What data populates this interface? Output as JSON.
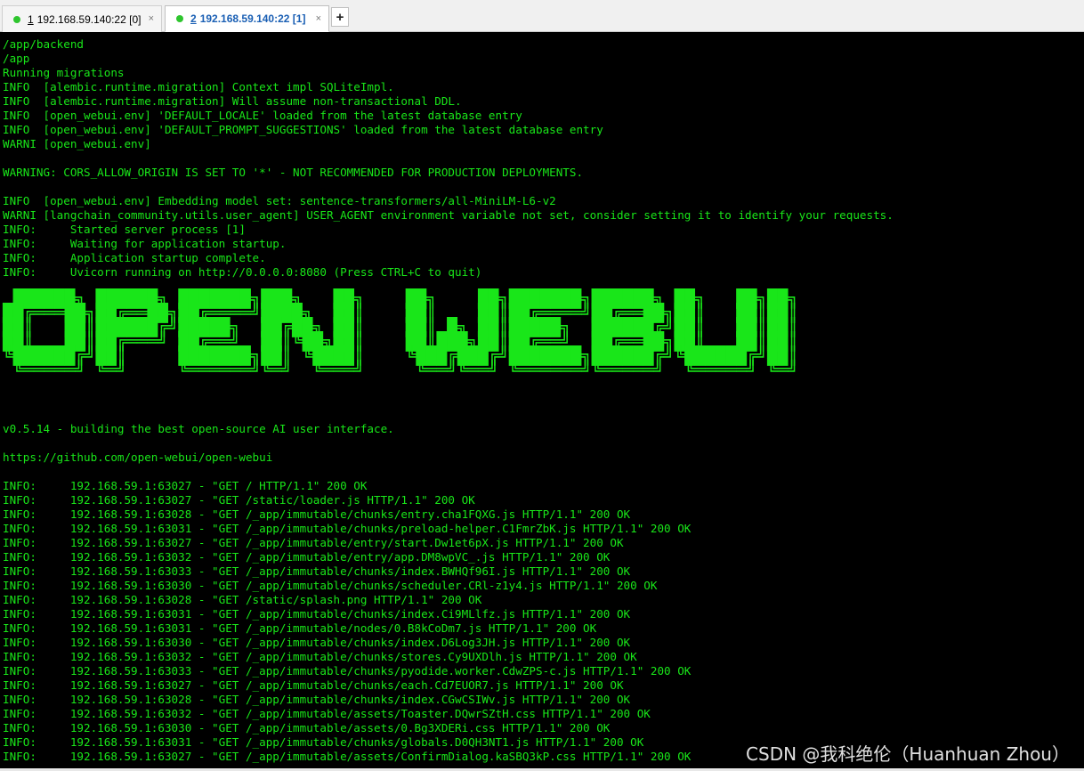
{
  "tabs": [
    {
      "index": "1",
      "label": "192.168.59.140:22 [0]",
      "status_color": "#2ec52e",
      "close": "×"
    },
    {
      "index": "2",
      "label": "192.168.59.140:22 [1]",
      "status_color": "#2ec52e",
      "close": "×"
    }
  ],
  "add_tab_label": "+",
  "terminal": {
    "text_color": "#19e619",
    "lines": [
      "/app/backend",
      "/app",
      "Running migrations",
      "INFO  [alembic.runtime.migration] Context impl SQLiteImpl.",
      "INFO  [alembic.runtime.migration] Will assume non-transactional DDL.",
      "INFO  [open_webui.env] 'DEFAULT_LOCALE' loaded from the latest database entry",
      "INFO  [open_webui.env] 'DEFAULT_PROMPT_SUGGESTIONS' loaded from the latest database entry",
      "WARNI [open_webui.env]",
      "",
      "WARNING: CORS_ALLOW_ORIGIN IS SET TO '*' - NOT RECOMMENDED FOR PRODUCTION DEPLOYMENTS.",
      "",
      "INFO  [open_webui.env] Embedding model set: sentence-transformers/all-MiniLM-L6-v2",
      "WARNI [langchain_community.utils.user_agent] USER_AGENT environment variable not set, consider setting it to identify your requests.",
      "INFO:     Started server process [1]",
      "INFO:     Waiting for application startup.",
      "INFO:     Application startup complete.",
      "INFO:     Uvicorn running on http://0.0.0.0:8080 (Press CTRL+C to quit)",
      "",
      "",
      "",
      "",
      "",
      "",
      "",
      "",
      "",
      "",
      "v0.5.14 - building the best open-source AI user interface.",
      "",
      "https://github.com/open-webui/open-webui",
      "",
      "INFO:     192.168.59.1:63027 - \"GET / HTTP/1.1\" 200 OK",
      "INFO:     192.168.59.1:63027 - \"GET /static/loader.js HTTP/1.1\" 200 OK",
      "INFO:     192.168.59.1:63028 - \"GET /_app/immutable/chunks/entry.cha1FQXG.js HTTP/1.1\" 200 OK",
      "INFO:     192.168.59.1:63031 - \"GET /_app/immutable/chunks/preload-helper.C1FmrZbK.js HTTP/1.1\" 200 OK",
      "INFO:     192.168.59.1:63027 - \"GET /_app/immutable/entry/start.Dw1et6pX.js HTTP/1.1\" 200 OK",
      "INFO:     192.168.59.1:63032 - \"GET /_app/immutable/entry/app.DM8wpVC_.js HTTP/1.1\" 200 OK",
      "INFO:     192.168.59.1:63033 - \"GET /_app/immutable/chunks/index.BWHQf96I.js HTTP/1.1\" 200 OK",
      "INFO:     192.168.59.1:63030 - \"GET /_app/immutable/chunks/scheduler.CRl-z1y4.js HTTP/1.1\" 200 OK",
      "INFO:     192.168.59.1:63028 - \"GET /static/splash.png HTTP/1.1\" 200 OK",
      "INFO:     192.168.59.1:63031 - \"GET /_app/immutable/chunks/index.Ci9MLlfz.js HTTP/1.1\" 200 OK",
      "INFO:     192.168.59.1:63031 - \"GET /_app/immutable/nodes/0.B8kCoDm7.js HTTP/1.1\" 200 OK",
      "INFO:     192.168.59.1:63030 - \"GET /_app/immutable/chunks/index.D6Log3JH.js HTTP/1.1\" 200 OK",
      "INFO:     192.168.59.1:63032 - \"GET /_app/immutable/chunks/stores.Cy9UXDlh.js HTTP/1.1\" 200 OK",
      "INFO:     192.168.59.1:63033 - \"GET /_app/immutable/chunks/pyodide.worker.CdwZPS-c.js HTTP/1.1\" 200 OK",
      "INFO:     192.168.59.1:63027 - \"GET /_app/immutable/chunks/each.Cd7EUOR7.js HTTP/1.1\" 200 OK",
      "INFO:     192.168.59.1:63028 - \"GET /_app/immutable/chunks/index.CGwCSIWv.js HTTP/1.1\" 200 OK",
      "INFO:     192.168.59.1:63032 - \"GET /_app/immutable/assets/Toaster.DQwrSZtH.css HTTP/1.1\" 200 OK",
      "INFO:     192.168.59.1:63030 - \"GET /_app/immutable/assets/0.Bg3XDERi.css HTTP/1.1\" 200 OK",
      "INFO:     192.168.59.1:63031 - \"GET /_app/immutable/chunks/globals.D0QH3NT1.js HTTP/1.1\" 200 OK",
      "INFO:     192.168.59.1:63027 - \"GET /_app/immutable/assets/ConfirmDialog.kaSBQ3kP.css HTTP/1.1\" 200 OK"
    ],
    "banner_lines": [
      " ██████╗ ██████╗ ███████╗███╗   ██╗    ██╗    ██╗███████╗██████╗ ██╗   ██╗██╗",
      "██╔═══██╗██╔══██╗██╔════╝████╗  ██║    ██║    ██║██╔════╝██╔══██╗██║   ██║██║",
      "██║   ██║██████╔╝█████╗  ██╔██╗ ██║    ██║ █╗ ██║█████╗  ██████╔╝██║   ██║██║",
      "██║   ██║██╔═══╝ ██╔══╝  ██║╚██╗██║    ██║███╗██║██╔══╝  ██╔══██╗██║   ██║██║",
      "╚██████╔╝██║     ███████╗██║ ╚████║    ╚███╔███╔╝███████╗██████╔╝╚██████╔╝██║",
      " ╚═════╝ ╚═╝     ╚══════╝╚═╝  ╚═══╝     ╚══╝╚══╝ ╚══════╝╚═════╝  ╚═════╝ ╚═╝"
    ]
  },
  "watermark": "CSDN @我科绝伦（Huanhuan Zhou）"
}
